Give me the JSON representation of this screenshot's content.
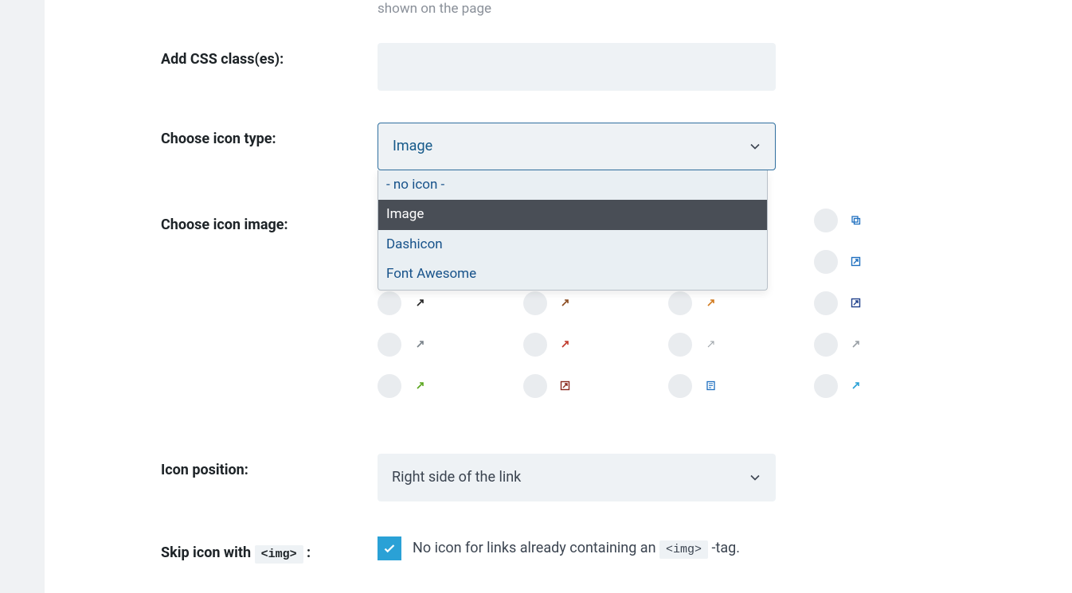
{
  "helper_tail": "shown on the page",
  "labels": {
    "add_css_classes": "Add CSS class(es):",
    "choose_icon_type": "Choose icon type:",
    "choose_icon_image": "Choose icon image:",
    "icon_position": "Icon position:",
    "skip_icon_prefix": "Skip icon with ",
    "skip_icon_code": "<img>",
    "skip_icon_suffix": " :"
  },
  "fields": {
    "css_classes_value": "",
    "icon_type_selected": "Image",
    "icon_type_options": [
      "- no icon -",
      "Image",
      "Dashicon",
      "Font Awesome"
    ],
    "icon_position_selected": "Right side of the link"
  },
  "checkbox": {
    "skip_img_checked": true,
    "skip_img_text_pre": "No icon for links already containing an ",
    "skip_img_code": "<img>",
    "skip_img_text_post": " -tag."
  },
  "icon_grid": [
    {
      "name": "ext-link-copy-blue",
      "color": "#1e6fbf"
    },
    {
      "name": "ext-link-copy-teal",
      "color": "#0f8a8a"
    },
    {
      "name": "ext-link-copy-navy",
      "color": "#1e3f8a"
    },
    {
      "name": "ext-link-copy-blue2",
      "color": "#1e6fbf"
    },
    {
      "name": "ext-link-arrow-blue",
      "color": "#1e6fbf"
    },
    {
      "name": "ext-link-arrow-teal",
      "color": "#0f8a8a"
    },
    {
      "name": "ext-link-arrow-navy",
      "color": "#1e3f8a"
    },
    {
      "name": "ext-link-box-blue",
      "color": "#1e6fbf"
    },
    {
      "name": "ext-link-arrow-black",
      "color": "#222"
    },
    {
      "name": "ext-link-arrow-brown",
      "color": "#8a4a1e"
    },
    {
      "name": "ext-link-arrow-orange",
      "color": "#d17a1e"
    },
    {
      "name": "ext-link-box-navy",
      "color": "#1e3f8a"
    },
    {
      "name": "ext-link-arrow-gray",
      "color": "#7a828a"
    },
    {
      "name": "ext-link-arrow-red",
      "color": "#c0392b"
    },
    {
      "name": "ext-link-arrow-outline-gray",
      "color": "#9aa0a6"
    },
    {
      "name": "ext-link-arrow-gray2",
      "color": "#9aa0a6"
    },
    {
      "name": "ext-link-arrow-green",
      "color": "#5aa61e"
    },
    {
      "name": "ext-link-arrow-redbox",
      "color": "#8a2a1e"
    },
    {
      "name": "ext-link-doc-blue",
      "color": "#1e6fbf"
    },
    {
      "name": "ext-link-arrow-sky",
      "color": "#2aa1d6"
    }
  ]
}
